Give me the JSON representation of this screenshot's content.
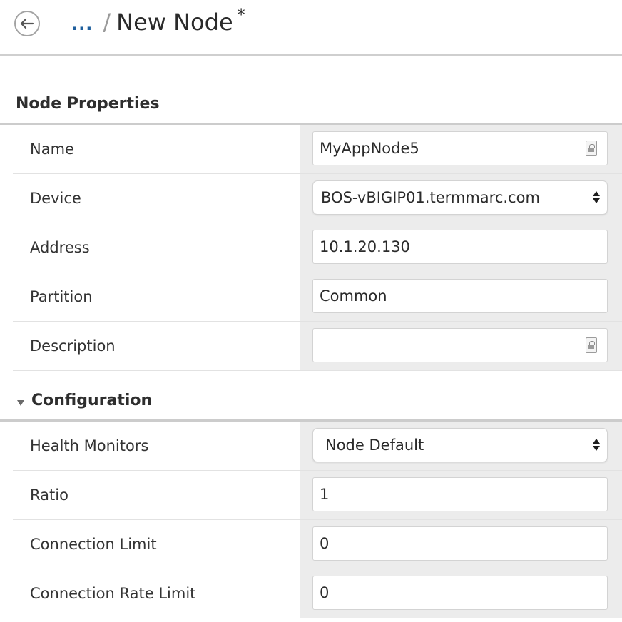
{
  "header": {
    "ellipsis": "...",
    "separator": "/",
    "title": "New Node",
    "unsaved_marker": "*"
  },
  "node_properties": {
    "heading": "Node Properties",
    "fields": {
      "name": {
        "label": "Name",
        "value": "MyAppNode5"
      },
      "device": {
        "label": "Device",
        "value": "BOS-vBIGIP01.termmarc.com"
      },
      "address": {
        "label": "Address",
        "value": "10.1.20.130"
      },
      "partition": {
        "label": "Partition",
        "value": "Common"
      },
      "description": {
        "label": "Description",
        "value": ""
      }
    }
  },
  "configuration": {
    "heading": "Configuration",
    "expanded": true,
    "fields": {
      "health_monitors": {
        "label": "Health Monitors",
        "value": "Node Default"
      },
      "ratio": {
        "label": "Ratio",
        "value": "1"
      },
      "connection_limit": {
        "label": "Connection Limit",
        "value": "0"
      },
      "connection_rate_limit": {
        "label": "Connection Rate Limit",
        "value": "0"
      }
    }
  },
  "icons": {
    "back": "back-arrow-icon",
    "text_lock": "text-lock-icon",
    "select_arrows": "select-arrows-icon",
    "expand_caret": "caret-down-icon"
  },
  "colors": {
    "link": "#1f5f9d",
    "value_column_bg": "#ececec",
    "divider": "#cccccc"
  }
}
